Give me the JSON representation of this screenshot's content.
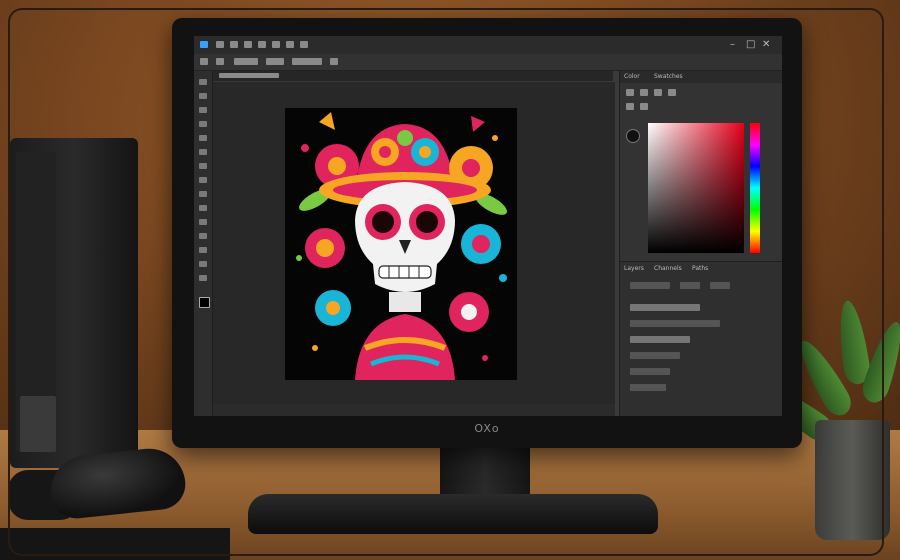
{
  "monitor": {
    "brand_label": "OXo"
  },
  "app": {
    "right_panel_tabs": [
      "Color",
      "Swatches"
    ],
    "layers_panel_tabs": [
      "Layers",
      "Channels",
      "Paths"
    ],
    "accent_colors": {
      "red": "#e6001a",
      "hue_top": "#ff0000"
    }
  },
  "artwork": {
    "subject": "skull-with-flower-hat",
    "palette": [
      "#e0245e",
      "#f6a623",
      "#19b5d6",
      "#7ac943",
      "#f2f2f2"
    ]
  },
  "icons": [
    "monitor",
    "speaker",
    "mouse",
    "keyboard",
    "plant"
  ]
}
